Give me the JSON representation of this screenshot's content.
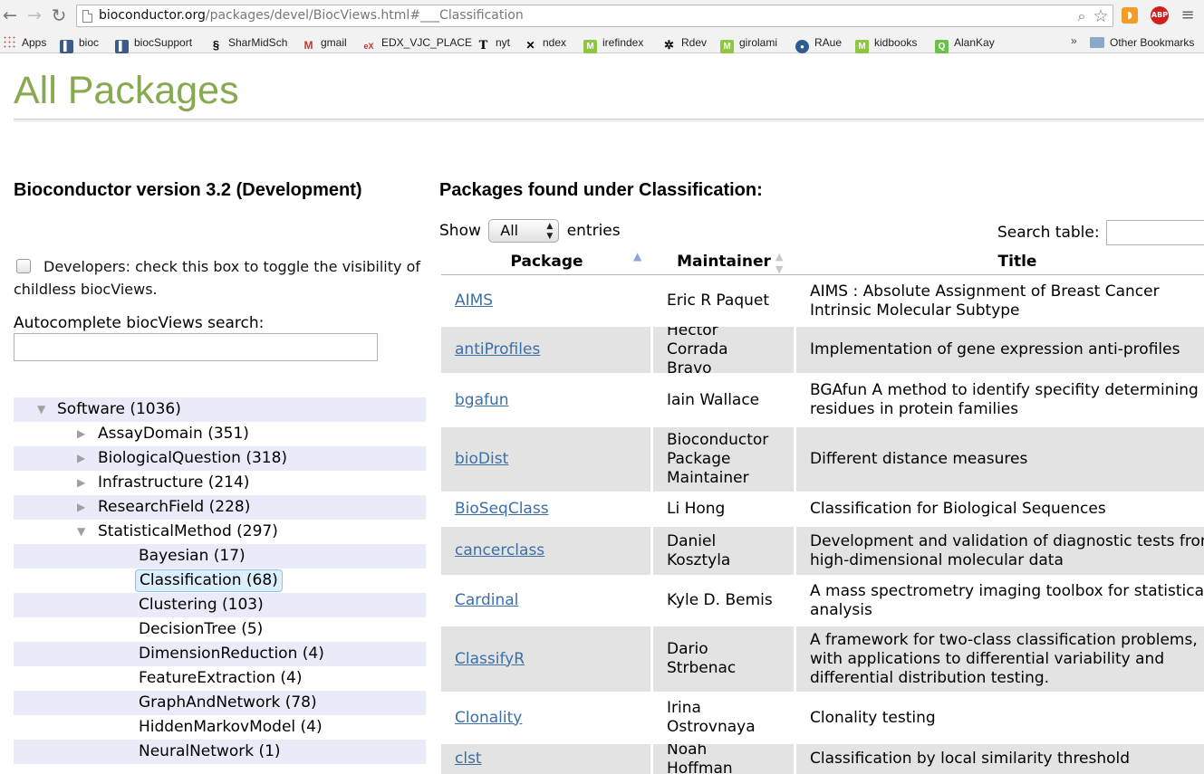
{
  "browser": {
    "url_domain": "bioconductor.org",
    "url_path": "/packages/devel/BiocViews.html#___Classification",
    "abp_label": "ABP",
    "bookmarks": [
      "Apps",
      "bioc",
      "biocSupport",
      "SharMidSch",
      "gmail",
      "EDX_VJC_PLACE",
      "nyt",
      "ndex",
      "irefindex",
      "Rdev",
      "girolami",
      "RAue",
      "kidbooks",
      "AlanKay"
    ],
    "bookmarks_more": "»",
    "other_bookmarks": "Other Bookmarks"
  },
  "page": {
    "title": "All Packages",
    "version_heading": "Bioconductor version 3.2 (Development)",
    "developer_toggle": "Developers: check this box to toggle the visibility of childless biocViews.",
    "autocomplete_label": "Autocomplete biocViews search:",
    "autocomplete_value": ""
  },
  "tree": [
    {
      "label": "Software (1036)",
      "level": 0,
      "expanded": true
    },
    {
      "label": "AssayDomain (351)",
      "level": 1,
      "expanded": false
    },
    {
      "label": "BiologicalQuestion (318)",
      "level": 1,
      "expanded": false
    },
    {
      "label": "Infrastructure (214)",
      "level": 1,
      "expanded": false
    },
    {
      "label": "ResearchField (228)",
      "level": 1,
      "expanded": false
    },
    {
      "label": "StatisticalMethod (297)",
      "level": 1,
      "expanded": true
    },
    {
      "label": "Bayesian (17)",
      "level": 2
    },
    {
      "label": "Classification (68)",
      "level": 2,
      "selected": true
    },
    {
      "label": "Clustering (103)",
      "level": 2
    },
    {
      "label": "DecisionTree (5)",
      "level": 2
    },
    {
      "label": "DimensionReduction (4)",
      "level": 2
    },
    {
      "label": "FeatureExtraction (4)",
      "level": 2
    },
    {
      "label": "GraphAndNetwork (78)",
      "level": 2
    },
    {
      "label": "HiddenMarkovModel (4)",
      "level": 2
    },
    {
      "label": "NeuralNetwork (1)",
      "level": 2
    }
  ],
  "packages": {
    "heading": "Packages found under Classification:",
    "show_label": "Show",
    "show_value": "All",
    "entries_label": "entries",
    "search_label": "Search table:",
    "search_value": "",
    "columns": [
      "Package",
      "Maintainer",
      "Title"
    ],
    "rows": [
      {
        "package": "AIMS",
        "maintainer": "Eric R Paquet",
        "title": "AIMS : Absolute Assignment of Breast Cancer Intrinsic Molecular Subtype"
      },
      {
        "package": "antiProfiles",
        "maintainer": "Hector Corrada Bravo",
        "title": "Implementation of gene expression anti-profiles"
      },
      {
        "package": "bgafun",
        "maintainer": "Iain Wallace",
        "title": "BGAfun A method to identify specifity determining residues in protein families"
      },
      {
        "package": "bioDist",
        "maintainer": "Bioconductor Package Maintainer",
        "title": "Different distance measures"
      },
      {
        "package": "BioSeqClass",
        "maintainer": "Li Hong",
        "title": "Classification for Biological Sequences"
      },
      {
        "package": "cancerclass",
        "maintainer": "Daniel Kosztyla",
        "title": "Development and validation of diagnostic tests from high-dimensional molecular data"
      },
      {
        "package": "Cardinal",
        "maintainer": "Kyle D. Bemis",
        "title": "A mass spectrometry imaging toolbox for statistical analysis"
      },
      {
        "package": "ClassifyR",
        "maintainer": "Dario Strbenac",
        "title": "A framework for two-class classification problems, with applications to differential variability and differential distribution testing."
      },
      {
        "package": "Clonality",
        "maintainer": "Irina Ostrovnaya",
        "title": "Clonality testing"
      },
      {
        "package": "clst",
        "maintainer": "Noah Hoffman",
        "title": "Classification by local similarity threshold"
      }
    ]
  }
}
